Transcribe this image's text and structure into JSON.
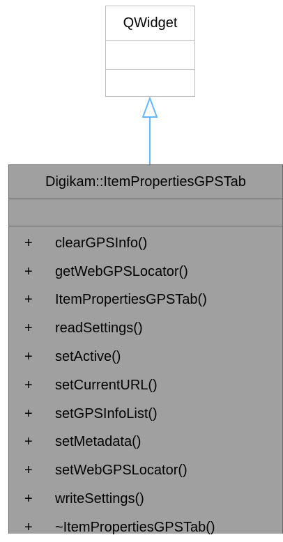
{
  "base_class": {
    "name": "QWidget"
  },
  "derived_class": {
    "name": "Digikam::ItemPropertiesGPSTab",
    "methods": [
      {
        "visibility": "+",
        "name": "clearGPSInfo()"
      },
      {
        "visibility": "+",
        "name": "getWebGPSLocator()"
      },
      {
        "visibility": "+",
        "name": "ItemPropertiesGPSTab()"
      },
      {
        "visibility": "+",
        "name": "readSettings()"
      },
      {
        "visibility": "+",
        "name": "setActive()"
      },
      {
        "visibility": "+",
        "name": "setCurrentURL()"
      },
      {
        "visibility": "+",
        "name": "setGPSInfoList()"
      },
      {
        "visibility": "+",
        "name": "setMetadata()"
      },
      {
        "visibility": "+",
        "name": "setWebGPSLocator()"
      },
      {
        "visibility": "+",
        "name": "writeSettings()"
      },
      {
        "visibility": "+",
        "name": "~ItemPropertiesGPSTab()"
      }
    ]
  },
  "colors": {
    "arrow": "#63b8ff",
    "derived_fill": "#a0a0a0",
    "base_border": "#bdbdbd",
    "derived_border": "#666666"
  }
}
